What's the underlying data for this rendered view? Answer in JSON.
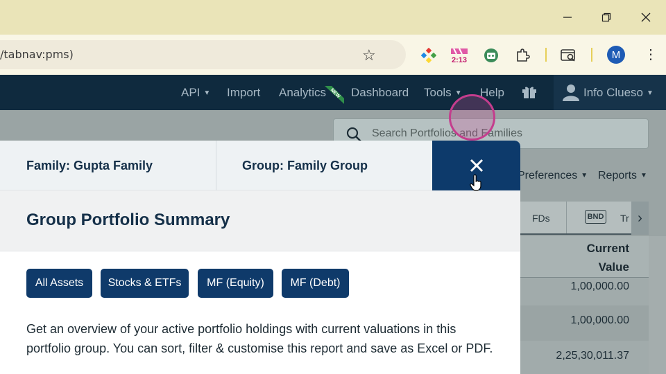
{
  "browser": {
    "url_text": "/tabnav:pms)",
    "extension_badge": "2:13",
    "profile_initial": "M"
  },
  "nav": {
    "items": [
      {
        "label": "API"
      },
      {
        "label": "Import"
      },
      {
        "label": "Analytics"
      },
      {
        "label": "Dashboard"
      },
      {
        "label": "Tools"
      },
      {
        "label": "Help"
      }
    ],
    "new_badge": "NEW",
    "user_label": "Info Clueso"
  },
  "page": {
    "search_placeholder": "Search Portfolios and Families",
    "preferences": "Preferences",
    "reports": "Reports",
    "tabs": {
      "fds": "FDs",
      "bnd": "BND",
      "trailing": "Tr"
    },
    "column_header_line1": "Current",
    "column_header_line2": "Value",
    "rows": [
      "1,00,000.00",
      "1,00,000.00",
      "2,25,30,011.37"
    ]
  },
  "modal": {
    "tab_family": "Family: Gupta Family",
    "tab_group": "Group: Family Group",
    "title": "Group Portfolio Summary",
    "chips": [
      "All Assets",
      "Stocks & ETFs",
      "MF (Equity)",
      "MF (Debt)"
    ],
    "description": "Get an overview of your active portfolio holdings with current valuations in this portfolio group. You can sort, filter & customise this report and save as Excel or PDF."
  },
  "colors": {
    "nav_bg": "#0f2a3e",
    "modal_accent": "#0d3a6b",
    "chip_bg": "#0f3a6a",
    "title_text": "#153049",
    "cursor_ring": "#c43d8d"
  },
  "icons": [
    "minimize-icon",
    "restore-icon",
    "close-window-icon",
    "star-icon",
    "extension-icon",
    "search-icon",
    "gift-icon",
    "user-icon",
    "close-icon",
    "hand-cursor-icon"
  ]
}
